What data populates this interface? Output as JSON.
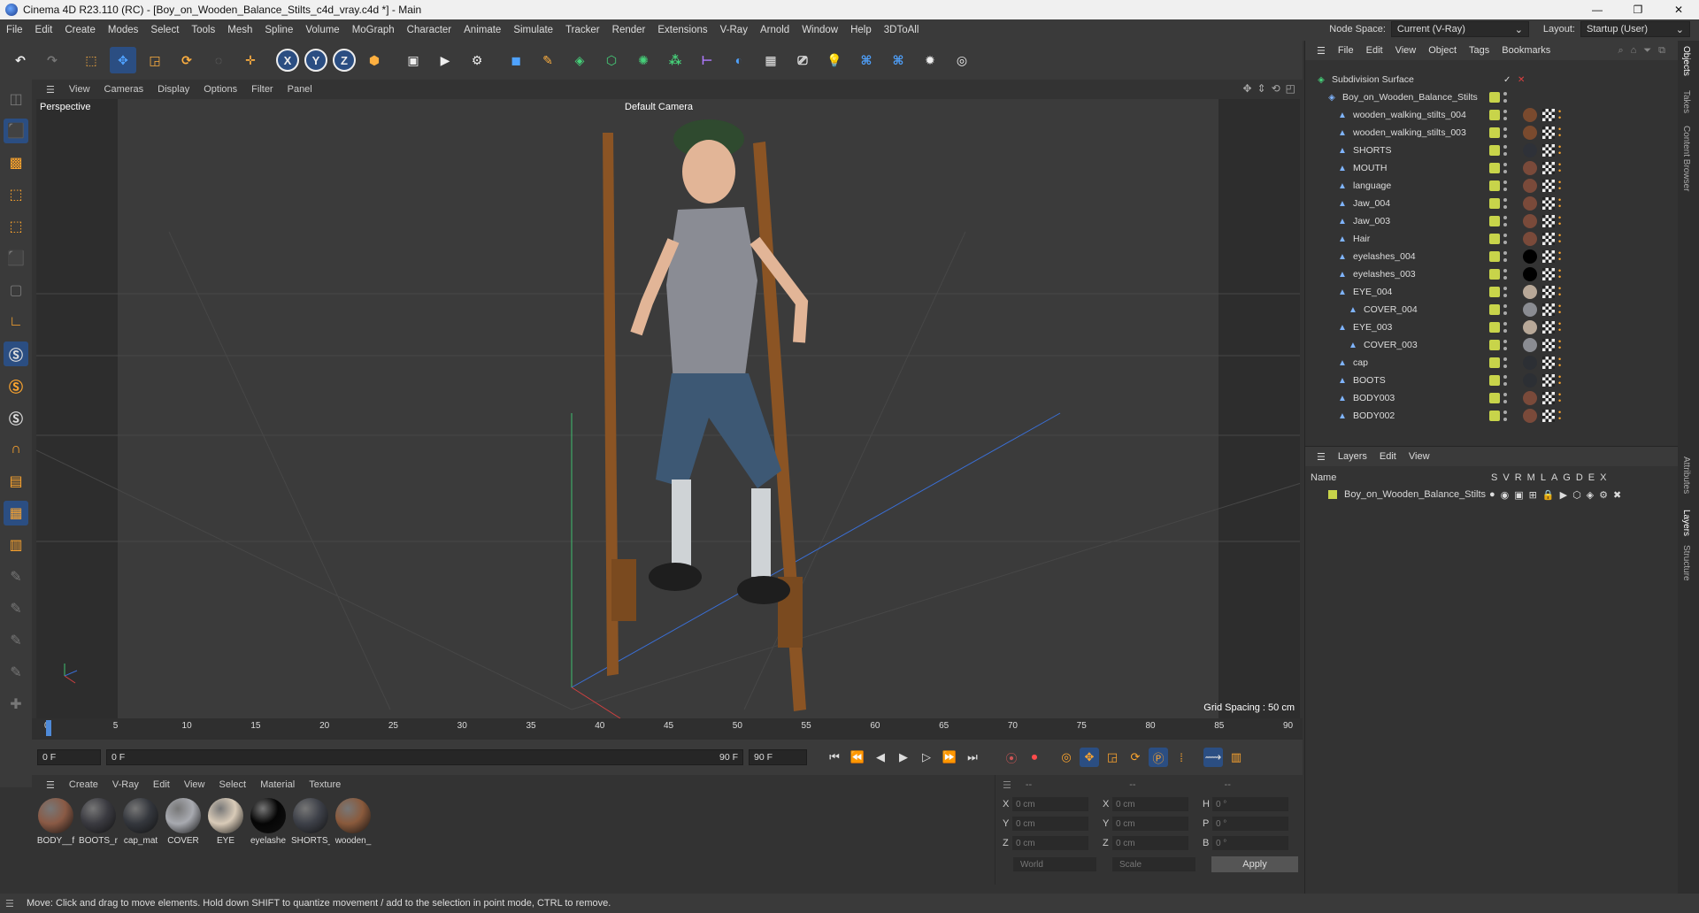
{
  "window": {
    "title": "Cinema 4D R23.110 (RC) - [Boy_on_Wooden_Balance_Stilts_c4d_vray.c4d *] - Main",
    "minimize": "—",
    "maximize": "❐",
    "close": "✕"
  },
  "menu": [
    "File",
    "Edit",
    "Create",
    "Modes",
    "Select",
    "Tools",
    "Mesh",
    "Spline",
    "Volume",
    "MoGraph",
    "Character",
    "Animate",
    "Simulate",
    "Tracker",
    "Render",
    "Extensions",
    "V-Ray",
    "Arnold",
    "Window",
    "Help",
    "3DToAll"
  ],
  "node_space": {
    "label": "Node Space:",
    "value": "Current (V-Ray)"
  },
  "layout": {
    "label": "Layout:",
    "value": "Startup (User)"
  },
  "toolbar": {
    "axes": [
      "X",
      "Y",
      "Z"
    ]
  },
  "viewport": {
    "menu": [
      "View",
      "Cameras",
      "Display",
      "Options",
      "Filter",
      "Panel"
    ],
    "label": "Perspective",
    "camera": "Default Camera",
    "grid_spacing": "Grid Spacing : 50 cm"
  },
  "timeline": {
    "ticks": [
      "0",
      "5",
      "10",
      "15",
      "20",
      "25",
      "30",
      "35",
      "40",
      "45",
      "50",
      "55",
      "60",
      "65",
      "70",
      "75",
      "80",
      "85",
      "90"
    ],
    "current_frame": "0 F",
    "start": "0 F",
    "scrub_start": "0 F",
    "scrub_end": "90 F",
    "end": "90 F",
    "right_field": "0 F"
  },
  "materials": {
    "menu": [
      "Create",
      "V-Ray",
      "Edit",
      "View",
      "Select",
      "Material",
      "Texture"
    ],
    "items": [
      {
        "label": "BODY__f",
        "color": "#8a5a45"
      },
      {
        "label": "BOOTS_r",
        "color": "#3a3a40"
      },
      {
        "label": "cap_mat",
        "color": "#34373d"
      },
      {
        "label": "COVER",
        "color": "#a8aab0"
      },
      {
        "label": "EYE",
        "color": "#d9cbb8"
      },
      {
        "label": "eyelashe",
        "color": "#050505"
      },
      {
        "label": "SHORTS_",
        "color": "#3d4048"
      },
      {
        "label": "wooden_",
        "color": "#8a5a3c"
      }
    ]
  },
  "coords": {
    "header": [
      "--",
      "--",
      "--"
    ],
    "rows": [
      {
        "a": "X",
        "v1": "0 cm",
        "b": "X",
        "v2": "0 cm",
        "c": "H",
        "v3": "0 °"
      },
      {
        "a": "Y",
        "v1": "0 cm",
        "b": "Y",
        "v2": "0 cm",
        "c": "P",
        "v3": "0 °"
      },
      {
        "a": "Z",
        "v1": "0 cm",
        "b": "Z",
        "v2": "0 cm",
        "c": "B",
        "v3": "0 °"
      }
    ],
    "world": "World",
    "scale": "Scale",
    "apply": "Apply"
  },
  "status": "Move: Click and drag to move elements. Hold down SHIFT to quantize movement / add to the selection in point mode, CTRL to remove.",
  "objects": {
    "menu": [
      "File",
      "Edit",
      "View",
      "Object",
      "Tags",
      "Bookmarks"
    ],
    "tree": [
      {
        "name": "Subdivision Surface",
        "depth": 0,
        "tag": "none"
      },
      {
        "name": "Boy_on_Wooden_Balance_Stilts",
        "depth": 1,
        "tag": "none"
      },
      {
        "name": "wooden_walking_stilts_004",
        "depth": 2,
        "tag": "#7a4a2e"
      },
      {
        "name": "wooden_walking_stilts_003",
        "depth": 2,
        "tag": "#7a4a2e"
      },
      {
        "name": "SHORTS",
        "depth": 2,
        "tag": "#2e3138"
      },
      {
        "name": "MOUTH",
        "depth": 2,
        "tag": "#7a4a3a"
      },
      {
        "name": "language",
        "depth": 2,
        "tag": "#7a4a3a"
      },
      {
        "name": "Jaw_004",
        "depth": 2,
        "tag": "#7a4a3a"
      },
      {
        "name": "Jaw_003",
        "depth": 2,
        "tag": "#7a4a3a"
      },
      {
        "name": "Hair",
        "depth": 2,
        "tag": "#7a4a3a"
      },
      {
        "name": "eyelashes_004",
        "depth": 2,
        "tag": "#000000"
      },
      {
        "name": "eyelashes_003",
        "depth": 2,
        "tag": "#000000"
      },
      {
        "name": "EYE_004",
        "depth": 2,
        "tag": "#b8a898"
      },
      {
        "name": "COVER_004",
        "depth": 3,
        "tag": "#8a8c92"
      },
      {
        "name": "EYE_003",
        "depth": 2,
        "tag": "#b8a898"
      },
      {
        "name": "COVER_003",
        "depth": 3,
        "tag": "#8a8c92"
      },
      {
        "name": "cap",
        "depth": 2,
        "tag": "#2c2f34"
      },
      {
        "name": "BOOTS",
        "depth": 2,
        "tag": "#2c2f34"
      },
      {
        "name": "BODY003",
        "depth": 2,
        "tag": "#7a4a3a"
      },
      {
        "name": "BODY002",
        "depth": 2,
        "tag": "#7a4a3a"
      }
    ]
  },
  "layers": {
    "menu": [
      "Layers",
      "Edit",
      "View"
    ],
    "name_header": "Name",
    "cols": [
      "S",
      "V",
      "R",
      "M",
      "L",
      "A",
      "G",
      "D",
      "E",
      "X"
    ],
    "items": [
      {
        "name": "Boy_on_Wooden_Balance_Stilts"
      }
    ]
  },
  "side_tabs": [
    "Objects",
    "Takes",
    "Content Browser",
    "Attributes",
    "Layers",
    "Structure"
  ]
}
